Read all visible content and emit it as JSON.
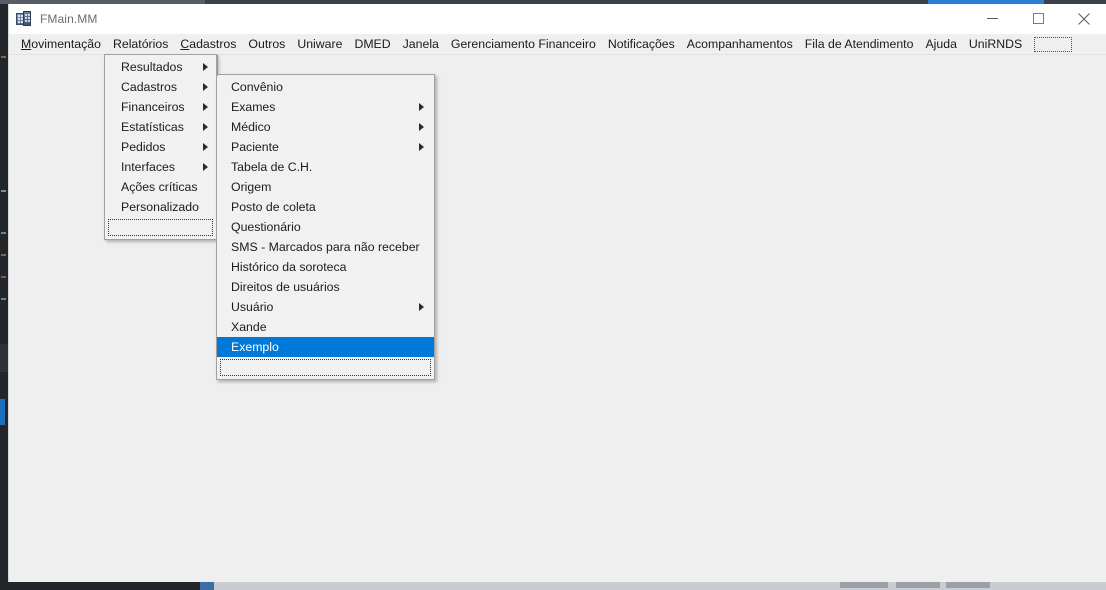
{
  "window": {
    "title": "FMain.MM",
    "icon": "app-window-icon",
    "controls": {
      "minimize": "minimize-icon",
      "maximize": "maximize-icon",
      "close": "close-icon"
    }
  },
  "menubar": {
    "items": [
      {
        "label": "Movimentação",
        "accel": "M",
        "accel_index": 0
      },
      {
        "label": "Relatórios",
        "accel": "",
        "accel_index": -1
      },
      {
        "label": "Cadastros",
        "accel": "C",
        "accel_index": 0
      },
      {
        "label": "Outros",
        "accel": "",
        "accel_index": -1
      },
      {
        "label": "Uniware",
        "accel": "",
        "accel_index": -1
      },
      {
        "label": "DMED",
        "accel": "",
        "accel_index": -1
      },
      {
        "label": "Janela",
        "accel": "",
        "accel_index": -1
      },
      {
        "label": "Gerenciamento Financeiro",
        "accel": "",
        "accel_index": -1
      },
      {
        "label": "Notificações",
        "accel": "",
        "accel_index": -1
      },
      {
        "label": "Acompanhamentos",
        "accel": "",
        "accel_index": -1
      },
      {
        "label": "Fila de Atendimento",
        "accel": "",
        "accel_index": -1
      },
      {
        "label": "Ajuda",
        "accel": "",
        "accel_index": -1
      },
      {
        "label": "UniRNDS",
        "accel": "",
        "accel_index": -1
      }
    ],
    "focus_box": ""
  },
  "menu_relatorios": {
    "items": [
      {
        "label": "Resultados",
        "submenu": true,
        "selected": false
      },
      {
        "label": "Cadastros",
        "submenu": true,
        "selected": false
      },
      {
        "label": "Financeiros",
        "submenu": true,
        "selected": false
      },
      {
        "label": "Estatísticas",
        "submenu": true,
        "selected": false
      },
      {
        "label": "Pedidos",
        "submenu": true,
        "selected": false
      },
      {
        "label": "Interfaces",
        "submenu": true,
        "selected": false
      },
      {
        "label": "Ações críticas",
        "submenu": false,
        "selected": false
      },
      {
        "label": "Personalizado",
        "submenu": false,
        "selected": false
      }
    ],
    "focus_row": ""
  },
  "menu_cadastros": {
    "items": [
      {
        "label": "Convênio",
        "submenu": false,
        "selected": false
      },
      {
        "label": "Exames",
        "submenu": true,
        "selected": false
      },
      {
        "label": "Médico",
        "submenu": true,
        "selected": false
      },
      {
        "label": "Paciente",
        "submenu": true,
        "selected": false
      },
      {
        "label": "Tabela de C.H.",
        "submenu": false,
        "selected": false
      },
      {
        "label": "Origem",
        "submenu": false,
        "selected": false
      },
      {
        "label": "Posto de coleta",
        "submenu": false,
        "selected": false
      },
      {
        "label": "Questionário",
        "submenu": false,
        "selected": false
      },
      {
        "label": "SMS - Marcados para não receber",
        "submenu": false,
        "selected": false
      },
      {
        "label": "Histórico da soroteca",
        "submenu": false,
        "selected": false
      },
      {
        "label": "Direitos de usuários",
        "submenu": false,
        "selected": false
      },
      {
        "label": "Usuário",
        "submenu": true,
        "selected": false
      },
      {
        "label": "Xande",
        "submenu": false,
        "selected": false
      },
      {
        "label": "Exemplo",
        "submenu": false,
        "selected": true
      }
    ],
    "focus_row": ""
  },
  "colors": {
    "selection": "#0078d7",
    "menu_background": "#f1f1f1",
    "window_background": "#efefef",
    "menu_border": "#a0a0a0",
    "title_text": "#6d6d6d"
  }
}
